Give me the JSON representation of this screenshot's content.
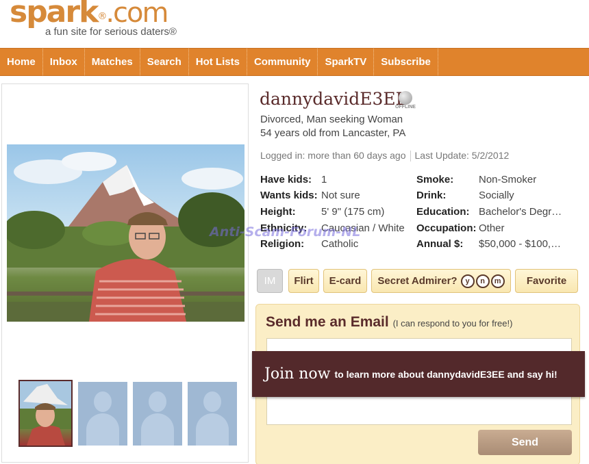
{
  "logo": {
    "name": "spark",
    "suffix": ".com",
    "registered": "®",
    "tagline": "a fun site for serious daters®"
  },
  "nav": [
    "Home",
    "Inbox",
    "Matches",
    "Search",
    "Hot Lists",
    "Community",
    "SparkTV",
    "Subscribe"
  ],
  "profile": {
    "username": "dannydavidE3EE",
    "status": "OFFLINE",
    "summary": "Divorced, Man seeking Woman",
    "age_location": "54 years old from Lancaster, PA",
    "logged_in": "Logged in: more than 60 days ago",
    "last_update": "Last Update: 5/2/2012"
  },
  "attributes_left": [
    {
      "label": "Have kids:",
      "value": "1"
    },
    {
      "label": "Wants kids:",
      "value": "Not sure"
    },
    {
      "label": "Height:",
      "value": "5' 9\" (175 cm)"
    },
    {
      "label": "Ethnicity:",
      "value": "Caucasian / White"
    },
    {
      "label": "Religion:",
      "value": "Catholic"
    }
  ],
  "attributes_right": [
    {
      "label": "Smoke:",
      "value": "Non-Smoker"
    },
    {
      "label": "Drink:",
      "value": "Socially"
    },
    {
      "label": "Education:",
      "value": "Bachelor's Degr…"
    },
    {
      "label": "Occupation:",
      "value": "Other"
    },
    {
      "label": "Annual $:",
      "value": "$50,000 - $100,…"
    }
  ],
  "watermark": "Anti-Scam-Forum-NL",
  "actions": {
    "im": "IM",
    "flirt": "Flirt",
    "ecard": "E-card",
    "secret_admirer": "Secret Admirer?",
    "ynm": [
      "y",
      "n",
      "m"
    ],
    "favorite": "Favorite"
  },
  "email": {
    "title": "Send me an Email",
    "subtitle": "(I can respond to you for free!)",
    "send": "Send"
  },
  "join": {
    "big": "Join now",
    "rest": "to learn more about dannydavidE3EE and say hi!"
  },
  "colors": {
    "nav_orange": "#e0832c",
    "logo_orange": "#d68a3a",
    "maroon": "#53292b",
    "button_cream": "#f9e7b1"
  }
}
